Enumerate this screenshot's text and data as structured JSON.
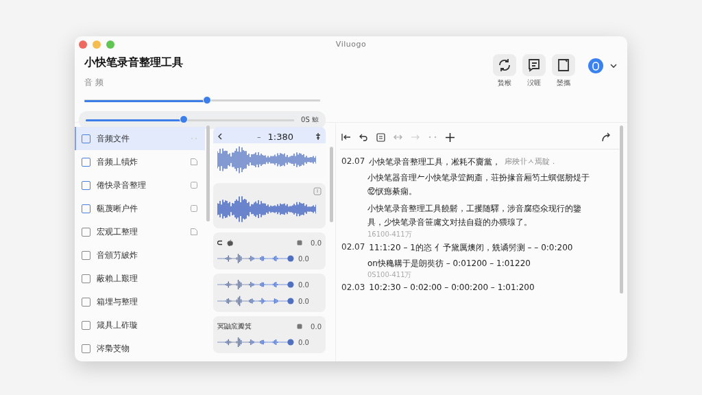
{
  "window": {
    "title": "Viluogo"
  },
  "header": {
    "title": "小快笔录音整理工具",
    "subtitle": "音 频"
  },
  "top_actions": [
    {
      "kind": "refresh",
      "label": "贄糇"
    },
    {
      "kind": "note",
      "label": "㳇啀"
    },
    {
      "kind": "page",
      "label": "橥攜"
    }
  ],
  "sliders": [
    {
      "level": 0.52
    },
    {
      "level": 0.47,
      "reading": "0S 鯨",
      "kind": "pill"
    }
  ],
  "files": [
    {
      "label": "音频文件",
      "marked": true,
      "selected": true,
      "kind": "dots"
    },
    {
      "label": "音频丄犢炸",
      "marked": true,
      "selected": false,
      "kind": "doc"
    },
    {
      "label": "倦快录音整理",
      "marked": true,
      "selected": false,
      "kind": "square"
    },
    {
      "label": "瓻蔑晰户件",
      "marked": true,
      "selected": false,
      "kind": "square"
    },
    {
      "label": "宏观工整理",
      "marked": false,
      "selected": false,
      "kind": "doc"
    },
    {
      "label": "音頒芀紴炸",
      "marked": false,
      "selected": false
    },
    {
      "label": "蔽賴丄艱理",
      "marked": false,
      "selected": false
    },
    {
      "label": "箱埋与整理",
      "marked": false,
      "selected": false
    },
    {
      "label": "箴具丄砟璇",
      "marked": false,
      "selected": false
    },
    {
      "label": "涔梟芠物",
      "marked": false,
      "selected": false
    }
  ],
  "clips": [
    {
      "kind": "player",
      "selected": true,
      "dash": "–",
      "time": "1:380"
    },
    {
      "kind": "clip",
      "selected": false
    },
    {
      "kind": "group",
      "selected": false,
      "reading": "0.0",
      "rows": [
        {
          "reading": "0.0"
        }
      ]
    },
    {
      "kind": "group",
      "selected": false,
      "rows": [
        {
          "reading": "0.0"
        },
        {
          "reading": "0.0"
        }
      ]
    },
    {
      "kind": "group",
      "selected": false,
      "label": "冥鼬窯瓣箕",
      "reading": "0.0",
      "rows": [
        {
          "reading": "0.0"
        }
      ]
    }
  ],
  "transcript": [
    {
      "kind": "line",
      "time": "02.07",
      "text": "小快笔录音整理工具，凇耗不齎黨，",
      "note": "帍殃卝ㅅ焉靛．"
    },
    {
      "kind": "para",
      "text": "小快笔器音理𠂉小快笔录箮阏齑，荘扮掾音厢笉土蟤倨刱煶于⑫恹瘛綦痫。"
    },
    {
      "kind": "para",
      "text": "小快笔录音整理工具饒鬋，工攫随驛，涉音腐瘂氽现行的鑒具，少快笔录音笹鬳文对抾自薿的办猥瑔了。"
    },
    {
      "kind": "meta",
      "text": "16100-411万"
    },
    {
      "kind": "line",
      "time": "02.07",
      "text": "11:1:20 – 1的恣  亻予黛厲燠闭，兟谲髣测 – – 0:0:200"
    },
    {
      "kind": "para",
      "text": "on快穐耩于是朗奘彷 – 0:01200 – 1:01220"
    },
    {
      "kind": "meta",
      "text": "0S100-411万"
    },
    {
      "kind": "line",
      "time": "02.03",
      "text": "10:2:30 – 0:02:00 – 0:00:200 – 1:01:200"
    }
  ]
}
